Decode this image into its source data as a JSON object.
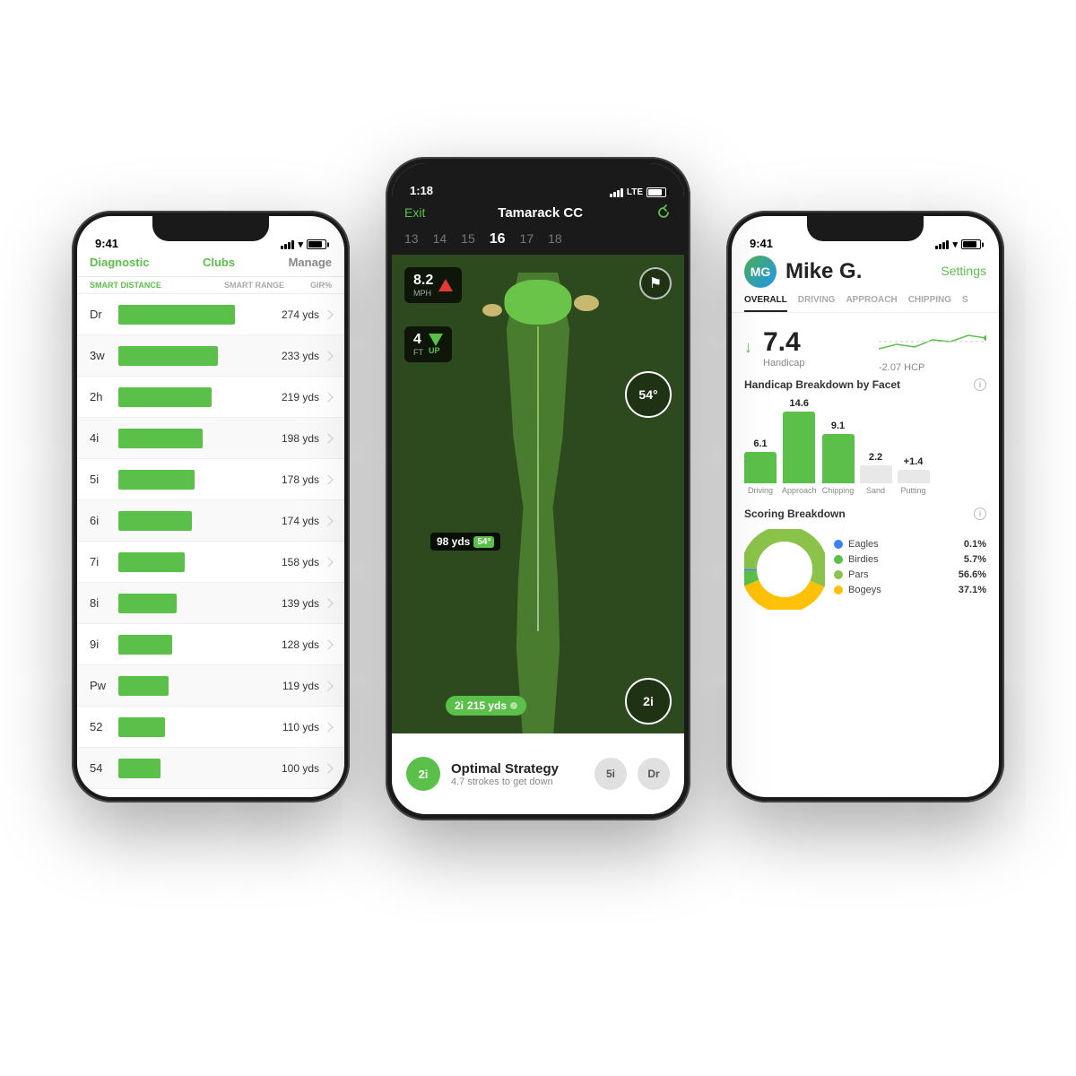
{
  "scene": {
    "background": "#ffffff"
  },
  "left_phone": {
    "status": {
      "time": "9:41",
      "signal": true,
      "wifi": true,
      "battery": true
    },
    "header": {
      "tab1": "Diagnostic",
      "tab2": "Clubs",
      "tab3": "Manage"
    },
    "columns": {
      "col1": "SMART DISTANCE",
      "col2": "SMART RANGE",
      "col3": "GIR%"
    },
    "clubs": [
      {
        "name": "Dr",
        "distance": "274 yds",
        "bar_pct": 100
      },
      {
        "name": "3w",
        "distance": "233 yds",
        "bar_pct": 85
      },
      {
        "name": "2h",
        "distance": "219 yds",
        "bar_pct": 80
      },
      {
        "name": "4i",
        "distance": "198 yds",
        "bar_pct": 72
      },
      {
        "name": "5i",
        "distance": "178 yds",
        "bar_pct": 65
      },
      {
        "name": "6i",
        "distance": "174 yds",
        "bar_pct": 63
      },
      {
        "name": "7i",
        "distance": "158 yds",
        "bar_pct": 57
      },
      {
        "name": "8i",
        "distance": "139 yds",
        "bar_pct": 50
      },
      {
        "name": "9i",
        "distance": "128 yds",
        "bar_pct": 46
      },
      {
        "name": "Pw",
        "distance": "119 yds",
        "bar_pct": 43
      },
      {
        "name": "52",
        "distance": "110 yds",
        "bar_pct": 40
      },
      {
        "name": "54",
        "distance": "100 yds",
        "bar_pct": 36
      }
    ]
  },
  "center_phone": {
    "status": {
      "time": "1:18",
      "signal": "LTE"
    },
    "header": {
      "exit": "Exit",
      "course": "Tamarack CC"
    },
    "holes": [
      {
        "num": "13",
        "active": false
      },
      {
        "num": "14",
        "active": false
      },
      {
        "num": "15",
        "active": false
      },
      {
        "num": "16",
        "active": true
      },
      {
        "num": "17",
        "active": false
      },
      {
        "num": "18",
        "active": false
      }
    ],
    "wind": {
      "speed": "8.2",
      "unit": "MPH",
      "direction": "down"
    },
    "elevation": {
      "value": "4",
      "unit": "FT",
      "direction": "UP"
    },
    "angle": "54°",
    "distance_badge": {
      "distance": "98 yds",
      "angle": "54°"
    },
    "player_club": {
      "name": "2i",
      "distance": "215 yds"
    },
    "optimal": {
      "club": "2i",
      "title": "Optimal Strategy",
      "subtitle": "4.7 strokes to get down",
      "alt1": "5i",
      "alt2": "Dr"
    }
  },
  "right_phone": {
    "status": {
      "time": "9:41",
      "signal": true,
      "wifi": true,
      "battery": true
    },
    "header": {
      "settings": "Settings"
    },
    "player": {
      "name": "Mike G.",
      "avatar_initials": "MG"
    },
    "tabs": [
      {
        "label": "OVERALL",
        "active": true
      },
      {
        "label": "DRIVING",
        "active": false
      },
      {
        "label": "APPROACH",
        "active": false
      },
      {
        "label": "CHIPPING",
        "active": false
      },
      {
        "label": "S",
        "active": false
      }
    ],
    "handicap": {
      "value": "7.4",
      "label": "Handicap",
      "change": "-2.07 HCP",
      "trend": "down"
    },
    "breakdown_title": "Handicap Breakdown by Facet",
    "facets": [
      {
        "name": "Driving",
        "value": "6.1",
        "type": "green"
      },
      {
        "name": "Approach",
        "value": "14.6",
        "type": "green"
      },
      {
        "name": "Chipping",
        "value": "9.1",
        "type": "green"
      },
      {
        "name": "Sand",
        "value": "2.2",
        "type": "gray"
      },
      {
        "name": "Putting",
        "value": "+1.4",
        "type": "pos"
      }
    ],
    "scoring_title": "Scoring Breakdown",
    "scoring": [
      {
        "label": "Eagles",
        "pct": "0.1%",
        "color": "#3b82f6",
        "value": 0.1
      },
      {
        "label": "Birdies",
        "pct": "5.7%",
        "color": "#5bc04a",
        "value": 5.7
      },
      {
        "label": "Pars",
        "pct": "56.6%",
        "color": "#8bc34a",
        "value": 56.6
      },
      {
        "label": "Bogeys",
        "pct": "37.1%",
        "color": "#ffc107",
        "value": 37.1
      }
    ]
  }
}
